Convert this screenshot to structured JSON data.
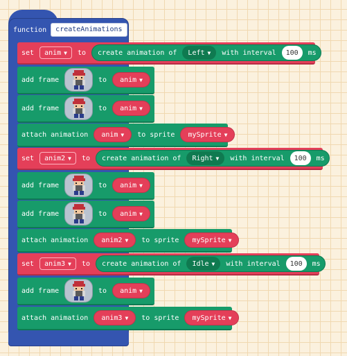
{
  "function": {
    "keyword": "function",
    "name": "createAnimations"
  },
  "labels": {
    "set": "set",
    "to": "to",
    "create_animation_of": "create animation of",
    "with_interval": "with interval",
    "ms": "ms",
    "add_frame": "add frame",
    "attach_animation": "attach animation",
    "to_sprite": "to sprite"
  },
  "colors": {
    "function_block": "#3455b0",
    "variable_block": "#e43f59",
    "animation_block": "#179b6a"
  },
  "blocks": [
    {
      "type": "set",
      "variable": "anim",
      "direction": "Left",
      "interval": "100"
    },
    {
      "type": "add_frame",
      "variable": "anim",
      "image": "trainer-sprite-icon"
    },
    {
      "type": "add_frame",
      "variable": "anim",
      "image": "trainer-sprite-icon"
    },
    {
      "type": "attach",
      "animation": "anim",
      "sprite": "mySprite"
    },
    {
      "type": "set",
      "variable": "anim2",
      "direction": "Right",
      "interval": "100"
    },
    {
      "type": "add_frame",
      "variable": "anim",
      "image": "trainer-sprite-icon"
    },
    {
      "type": "add_frame",
      "variable": "anim",
      "image": "trainer-sprite-icon"
    },
    {
      "type": "attach",
      "animation": "anim2",
      "sprite": "mySprite"
    },
    {
      "type": "set",
      "variable": "anim3",
      "direction": "Idle",
      "interval": "100"
    },
    {
      "type": "add_frame",
      "variable": "anim",
      "image": "trainer-sprite-icon"
    },
    {
      "type": "attach",
      "animation": "anim3",
      "sprite": "mySprite"
    }
  ]
}
